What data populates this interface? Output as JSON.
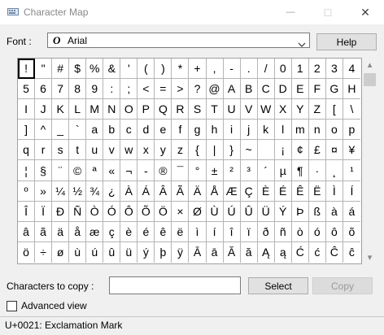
{
  "window": {
    "title": "Character Map",
    "min_glyph": "—",
    "max_glyph": "□",
    "close_glyph": "✕"
  },
  "font": {
    "label": "Font :",
    "icon_glyph": "O",
    "selected": "Arial",
    "arrow_glyph": "⌄"
  },
  "buttons": {
    "help": "Help",
    "select": "Select",
    "copy": "Copy"
  },
  "copy_field": {
    "label": "Characters to copy :",
    "value": ""
  },
  "advanced_view": {
    "label": "Advanced view",
    "checked": false
  },
  "status": {
    "text": "U+0021: Exclamation Mark"
  },
  "scrollbar": {
    "up_glyph": "▴",
    "down_glyph": "▾"
  },
  "grid": {
    "selected_index": 0,
    "characters": [
      "!",
      "\"",
      "#",
      "$",
      "%",
      "&",
      "'",
      "(",
      ")",
      "*",
      "+",
      ",",
      "-",
      ".",
      "/",
      "0",
      "1",
      "2",
      "3",
      "4",
      "5",
      "6",
      "7",
      "8",
      "9",
      ":",
      ";",
      "<",
      "=",
      ">",
      "?",
      "@",
      "A",
      "B",
      "C",
      "D",
      "E",
      "F",
      "G",
      "H",
      "I",
      "J",
      "K",
      "L",
      "M",
      "N",
      "O",
      "P",
      "Q",
      "R",
      "S",
      "T",
      "U",
      "V",
      "W",
      "X",
      "Y",
      "Z",
      "[",
      "\\",
      "]",
      "^",
      "_",
      "`",
      "a",
      "b",
      "c",
      "d",
      "e",
      "f",
      "g",
      "h",
      "i",
      "j",
      "k",
      "l",
      "m",
      "n",
      "o",
      "p",
      "q",
      "r",
      "s",
      "t",
      "u",
      "v",
      "w",
      "x",
      "y",
      "z",
      "{",
      "|",
      "}",
      "~",
      " ",
      "¡",
      "¢",
      "£",
      "¤",
      "¥",
      "¦",
      "§",
      "¨",
      "©",
      "ª",
      "«",
      "¬",
      "-",
      "®",
      "¯",
      "°",
      "±",
      "²",
      "³",
      "´",
      "µ",
      "¶",
      "·",
      "¸",
      "¹",
      "º",
      "»",
      "¼",
      "½",
      "¾",
      "¿",
      "À",
      "Á",
      "Â",
      "Ã",
      "Ä",
      "Å",
      "Æ",
      "Ç",
      "È",
      "É",
      "Ê",
      "Ë",
      "Ì",
      "Í",
      "Î",
      "Ï",
      "Ð",
      "Ñ",
      "Ò",
      "Ó",
      "Ô",
      "Õ",
      "Ö",
      "×",
      "Ø",
      "Ù",
      "Ú",
      "Û",
      "Ü",
      "Ý",
      "Þ",
      "ß",
      "à",
      "á",
      "â",
      "ã",
      "ä",
      "å",
      "æ",
      "ç",
      "è",
      "é",
      "ê",
      "ë",
      "ì",
      "í",
      "î",
      "ï",
      "ð",
      "ñ",
      "ò",
      "ó",
      "ô",
      "õ",
      "ö",
      "÷",
      "ø",
      "ù",
      "ú",
      "û",
      "ü",
      "ý",
      "þ",
      "ÿ",
      "Ā",
      "ā",
      "Ă",
      "ă",
      "Ą",
      "ą",
      "Ć",
      "ć",
      "Ĉ",
      "ĉ"
    ]
  }
}
